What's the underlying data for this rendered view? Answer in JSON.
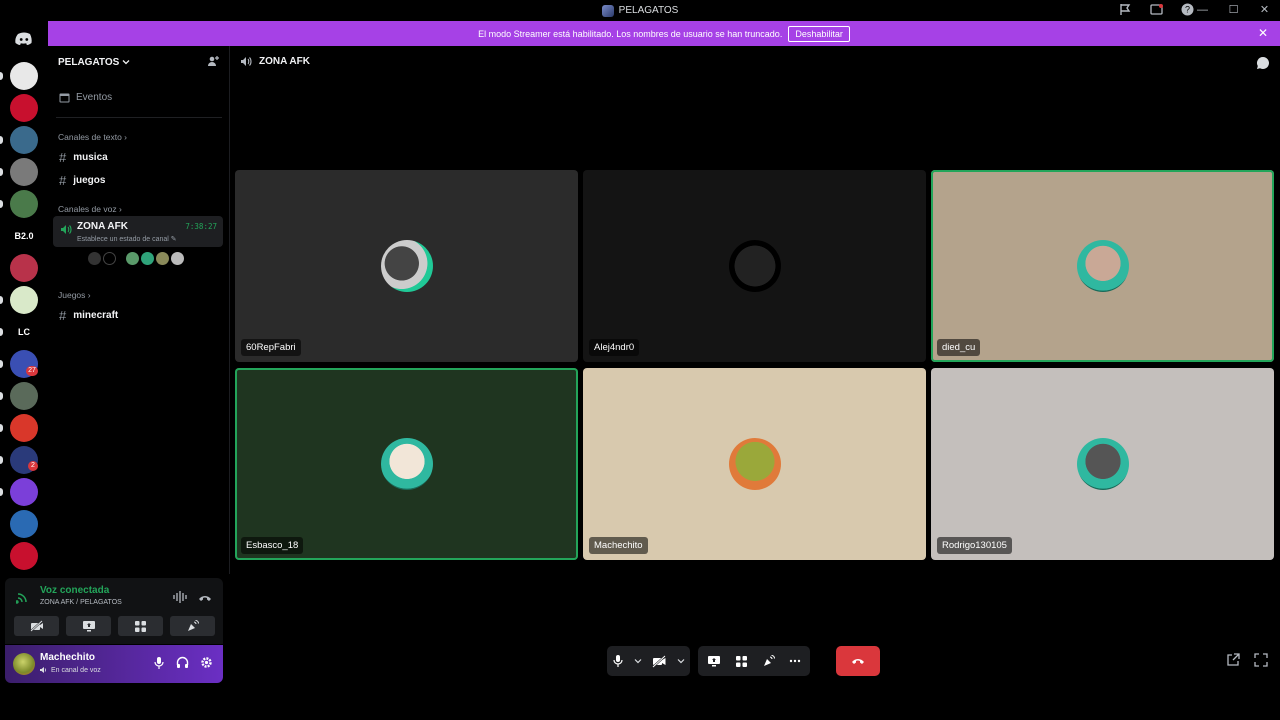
{
  "window": {
    "title": "PELAGATOS"
  },
  "banner": {
    "text": "El modo Streamer está habilitado. Los nombres de usuario se han truncado.",
    "button": "Deshabilitar"
  },
  "rail": {
    "servers": [
      {
        "label": "",
        "color": "#e8e8e8"
      },
      {
        "label": "",
        "color": "#c8102e"
      },
      {
        "label": "",
        "color": "#3a6a8c"
      },
      {
        "label": "",
        "color": "#7a7a7a"
      },
      {
        "label": "",
        "color": "#4a7a4a"
      },
      {
        "label": "B2.0",
        "color": "#000000"
      },
      {
        "label": "",
        "color": "#b8324a"
      },
      {
        "label": "",
        "color": "#d9e9c9"
      },
      {
        "label": "LC",
        "color": "#000000"
      },
      {
        "label": "",
        "color": "#3a4fb3"
      },
      {
        "label": "",
        "color": "#5a6a5a"
      },
      {
        "label": "",
        "color": "#d9372a"
      },
      {
        "label": "",
        "color": "#2a3a7a"
      },
      {
        "label": "",
        "color": "#7b3fd9"
      },
      {
        "label": "",
        "color": "#2a6ab3"
      },
      {
        "label": "",
        "color": "#c8102e"
      }
    ],
    "badges": [
      "27",
      "2"
    ]
  },
  "sidebar": {
    "guild_name": "PELAGATOS",
    "events_label": "Eventos",
    "text_category": "Canales de texto",
    "text_channels": [
      "musica",
      "juegos"
    ],
    "voice_category": "Canales de voz",
    "voice_channel": {
      "name": "ZONA AFK",
      "timer": "7:38:27",
      "status_placeholder": "Establece un estado de canal"
    },
    "games_category": "Juegos",
    "games_channels": [
      "minecraft"
    ]
  },
  "voice_panel": {
    "title": "Voz conectada",
    "subtitle": "ZONA AFK / PELAGATOS"
  },
  "user_panel": {
    "username": "Machechito",
    "status": "En canal de voz"
  },
  "stage": {
    "channel_name": "ZONA AFK",
    "tiles": [
      {
        "name": "60RepFabri",
        "bg": "#2b2b2b",
        "speaking": false
      },
      {
        "name": "Alej4ndr0",
        "bg": "#141414",
        "speaking": false
      },
      {
        "name": "died_cu",
        "bg": "#b4a38c",
        "speaking": true
      },
      {
        "name": "Esbasco_18",
        "bg": "#1f3520",
        "speaking": true
      },
      {
        "name": "Machechito",
        "bg": "#d8c9ae",
        "speaking": false
      },
      {
        "name": "Rodrigo130105",
        "bg": "#c4bfbc",
        "speaking": false
      }
    ]
  },
  "colors": {
    "accent": "#a641e6",
    "speaking": "#23a55a",
    "hangup": "#da373c"
  }
}
